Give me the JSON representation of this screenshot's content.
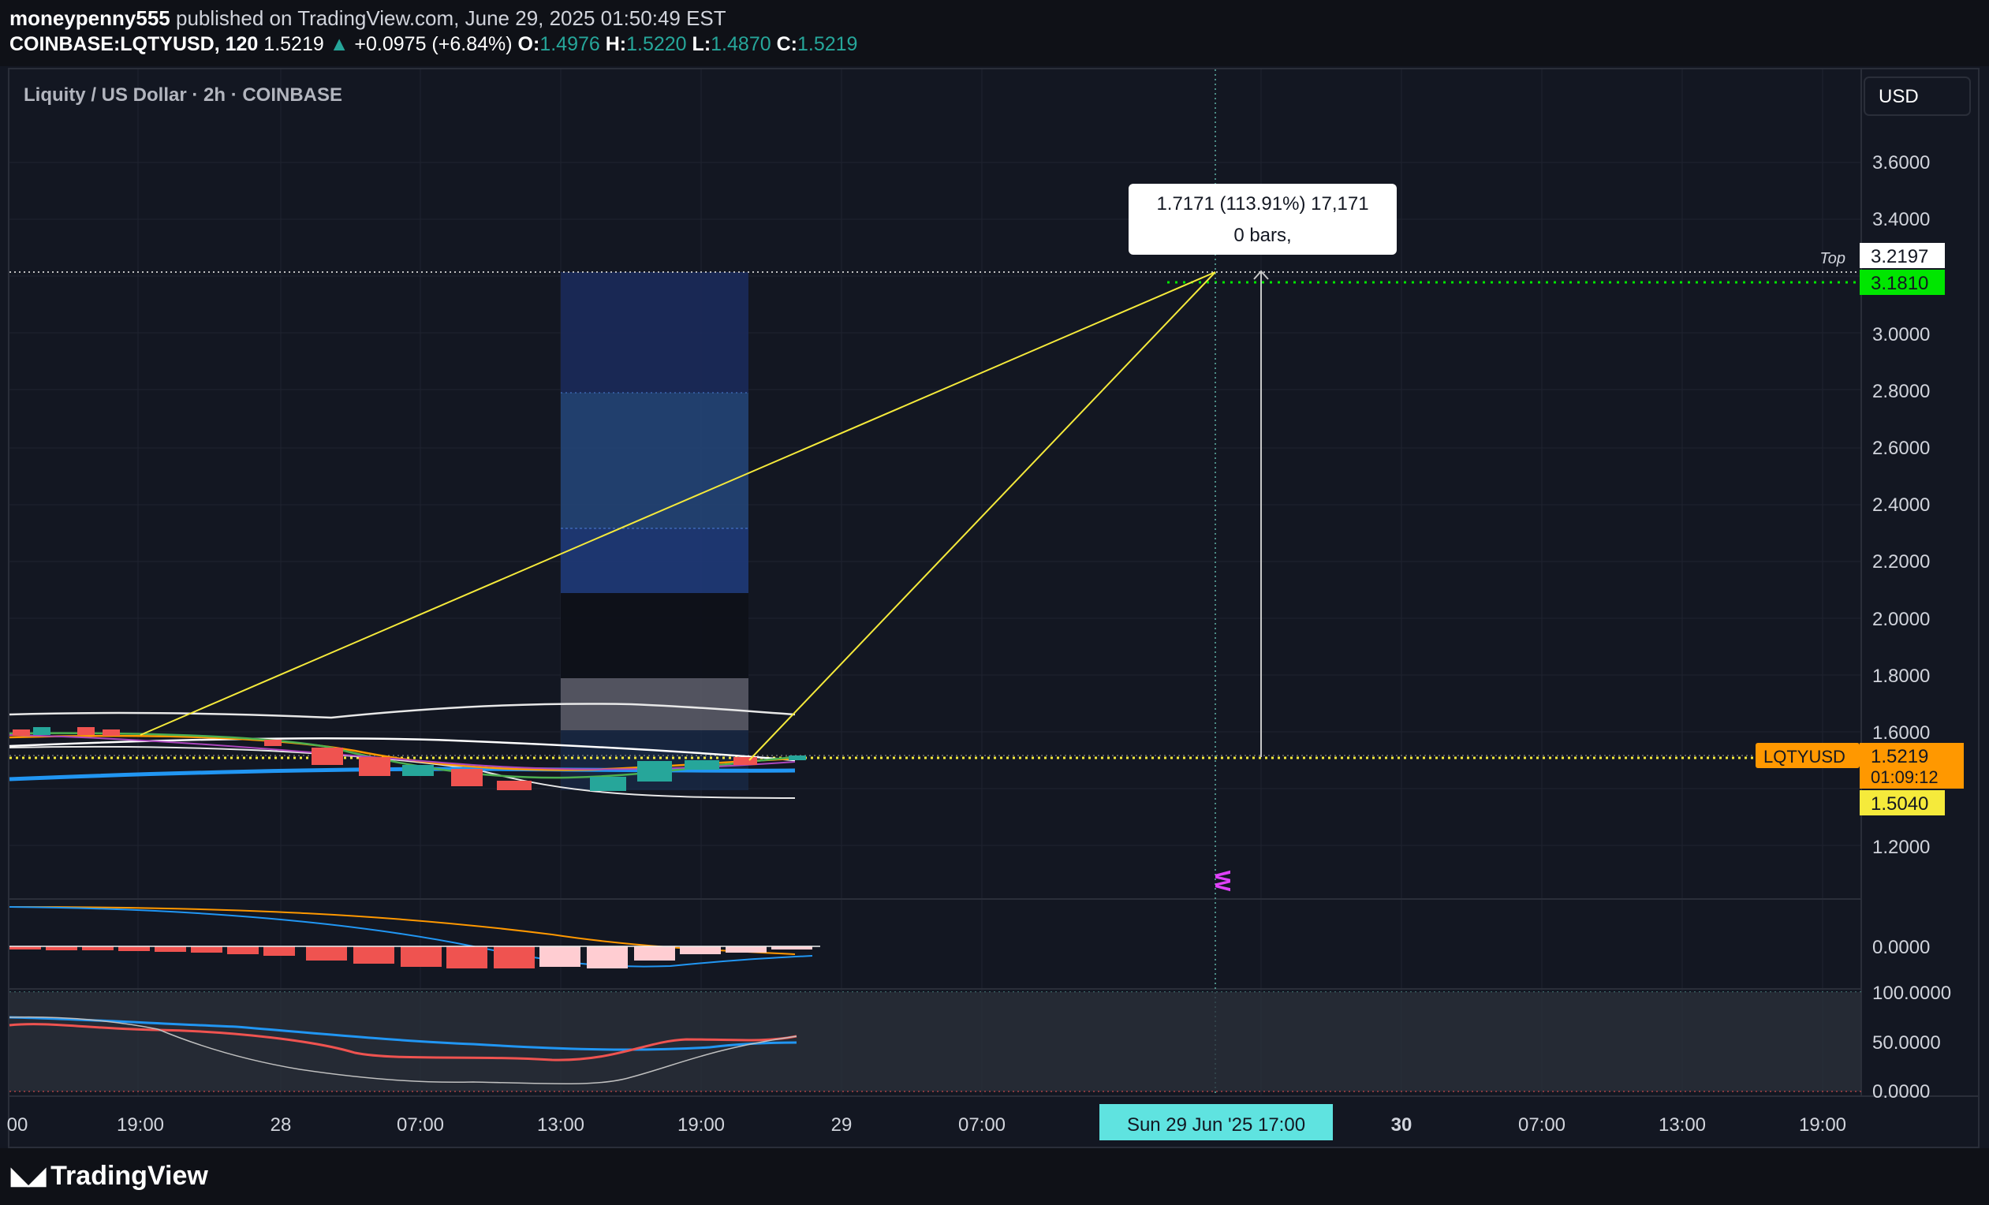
{
  "header": {
    "publisher": "moneypenny555",
    "published_text": "published on TradingView.com, June 29, 2025 01:50:49 EST",
    "symbol": "COINBASE:LQTYUSD, 120",
    "last": "1.5219",
    "change_arrow": "▲",
    "change": "+0.0975 (+6.84%)",
    "o_label": "O:",
    "o_value": "1.4976",
    "h_label": "H:",
    "h_value": "1.5220",
    "l_label": "L:",
    "l_value": "1.4870",
    "c_label": "C:",
    "c_value": "1.5219"
  },
  "chart": {
    "title": "Liquity / US Dollar · 2h · COINBASE",
    "currency_button": "USD",
    "price_ticks": [
      "3.6000",
      "3.4000",
      "3.0000",
      "2.8000",
      "2.6000",
      "2.4000",
      "2.2000",
      "2.0000",
      "1.8000",
      "1.6000",
      "1.2000"
    ],
    "time_ticks": [
      "00",
      "19:00",
      "28",
      "07:00",
      "13:00",
      "19:00",
      "29",
      "07:00",
      "30",
      "07:00",
      "13:00",
      "19:00"
    ],
    "crosshair_time": "Sun 29 Jun '25   17:00",
    "measure_tooltip_line1": "1.7171 (113.91%) 17,171",
    "measure_tooltip_line2": "0 bars,",
    "top_label": "Top",
    "price_labels": {
      "top_value": "3.2197",
      "target_value": "3.1810",
      "symbol_tag": "LQTYUSD",
      "last_price": "1.5219",
      "countdown": "01:09:12",
      "yellow_level": "1.5040"
    },
    "w_marker": "W",
    "macd_tick": "0.0000",
    "rsi_ticks": [
      "100.0000",
      "50.0000",
      "0.0000"
    ],
    "colors": {
      "background": "#131722",
      "grid": "#1f2330",
      "yellow": "#f5ea3b",
      "green_label": "#00e600",
      "orange": "#ff9800",
      "blue_ma": "#2196f3",
      "red_candle": "#ef5350",
      "green_candle": "#26a69a",
      "crosshair": "#5fb3a8",
      "marker_pink": "#e040fb"
    }
  },
  "footer": {
    "brand": "TradingView",
    "logo_icon": "tradingview-logo-icon"
  }
}
